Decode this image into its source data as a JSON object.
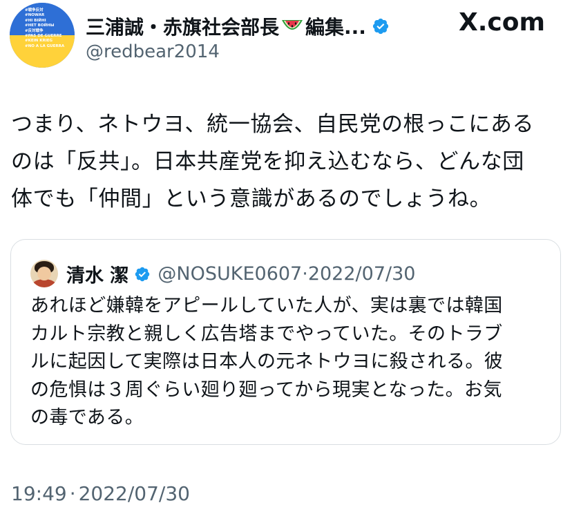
{
  "source": {
    "brand": "X.com",
    "icon": "x-logo-icon"
  },
  "author": {
    "name_prefix": "三浦誠・赤旗社会部長",
    "name_emoji_icon": "watermelon-icon",
    "name_suffix": "編集...",
    "verified_icon": "verified-badge-icon",
    "handle": "@redbear2014",
    "avatar_lines": [
      "#戦争反対",
      "#NOWAR",
      "#НІ ВІЙНІ",
      "#НЕТ ВОЙНЫ",
      "#反対戦争",
      "#PAS DE GUERRE",
      "#KEIN KRIEG",
      "#NO A LA GUERRA"
    ],
    "avatar_colors": {
      "top": "#2e6fd6",
      "bottom": "#ffd23a"
    }
  },
  "tweet": {
    "lines": [
      "つまり、ネトウヨ、統一協会、自民党の根っこにある",
      "のは「反共」。日本共産党を抑え込むなら、どんな団",
      "体でも「仲間」という意識があるのでしょうね。"
    ]
  },
  "quoted": {
    "name": "清水 潔",
    "verified_icon": "verified-badge-icon",
    "handle": "@NOSUKE0607",
    "separator": "·",
    "date": "2022/07/30",
    "lines": [
      "あれほど嫌韓をアピールしていた人が、実は裏では韓国",
      "カルト宗教と親しく広告塔までやっていた。そのトラブ",
      "ルに起因して実際は日本人の元ネトウヨに殺される。彼",
      "の危惧は３周ぐらい廻り廻ってから現実となった。お気",
      "の毒である。"
    ]
  },
  "footer": {
    "time": "19:49",
    "separator": "·",
    "date": "2022/07/30"
  },
  "colors": {
    "text": "#0f1419",
    "secondary": "#536471",
    "verified": "#1d9bf0",
    "border": "#d9dee2"
  }
}
